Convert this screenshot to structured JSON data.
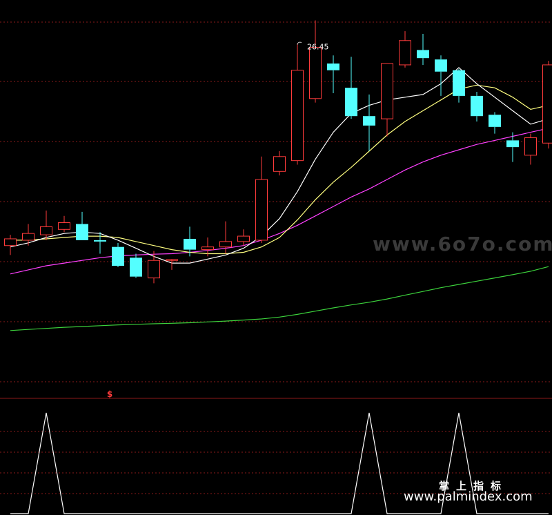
{
  "colors": {
    "background": "#000000",
    "grid": "#8b1a1a",
    "up_candle": "#ff3b3b",
    "down_candle": "#54ffff",
    "ma5": "#ffffff",
    "ma10": "#ffff80",
    "ma30": "#ff40ff",
    "ma60": "#3cd23c",
    "indicator": "#ffffff",
    "marker": "#ff3b3b"
  },
  "chart_data": [
    {
      "type": "candlestick",
      "title": "",
      "ylim": [
        13.0,
        27.0
      ],
      "grid": true,
      "high_annotation": {
        "label": "26.45",
        "candle_index": 16
      },
      "candles": [
        {
          "o": 18.1,
          "h": 18.5,
          "l": 17.75,
          "c": 18.35
        },
        {
          "o": 18.3,
          "h": 18.9,
          "l": 18.1,
          "c": 18.55
        },
        {
          "o": 18.5,
          "h": 19.4,
          "l": 18.3,
          "c": 18.8
        },
        {
          "o": 18.7,
          "h": 19.2,
          "l": 18.6,
          "c": 18.95
        },
        {
          "o": 18.9,
          "h": 19.35,
          "l": 18.4,
          "c": 18.3
        },
        {
          "o": 18.3,
          "h": 18.6,
          "l": 17.8,
          "c": 18.25
        },
        {
          "o": 18.05,
          "h": 18.2,
          "l": 17.3,
          "c": 17.35
        },
        {
          "o": 17.65,
          "h": 17.8,
          "l": 16.9,
          "c": 16.95
        },
        {
          "o": 16.9,
          "h": 17.9,
          "l": 16.7,
          "c": 17.55
        },
        {
          "o": 17.55,
          "h": 17.6,
          "l": 17.2,
          "c": 17.58
        },
        {
          "o": 18.35,
          "h": 18.8,
          "l": 17.7,
          "c": 17.95
        },
        {
          "o": 17.95,
          "h": 18.4,
          "l": 17.7,
          "c": 18.05
        },
        {
          "o": 18.05,
          "h": 19.0,
          "l": 17.8,
          "c": 18.25
        },
        {
          "o": 18.25,
          "h": 18.7,
          "l": 18.1,
          "c": 18.45
        },
        {
          "o": 18.3,
          "h": 21.4,
          "l": 18.2,
          "c": 20.55
        },
        {
          "o": 20.85,
          "h": 21.6,
          "l": 20.7,
          "c": 21.4
        },
        {
          "o": 21.25,
          "h": 25.6,
          "l": 21.1,
          "c": 24.6
        },
        {
          "o": 23.55,
          "h": 26.45,
          "l": 23.4,
          "c": 25.45
        },
        {
          "o": 24.85,
          "h": 25.15,
          "l": 23.75,
          "c": 24.6
        },
        {
          "o": 23.95,
          "h": 25.1,
          "l": 22.8,
          "c": 22.9
        },
        {
          "o": 22.9,
          "h": 23.7,
          "l": 21.6,
          "c": 22.55
        },
        {
          "o": 22.8,
          "h": 24.85,
          "l": 22.15,
          "c": 24.85
        },
        {
          "o": 24.8,
          "h": 26.05,
          "l": 24.7,
          "c": 25.7
        },
        {
          "o": 25.35,
          "h": 25.95,
          "l": 24.8,
          "c": 25.05
        },
        {
          "o": 25.0,
          "h": 25.15,
          "l": 23.65,
          "c": 24.55
        },
        {
          "o": 24.6,
          "h": 24.65,
          "l": 23.4,
          "c": 23.65
        },
        {
          "o": 23.65,
          "h": 23.8,
          "l": 22.7,
          "c": 22.9
        },
        {
          "o": 22.95,
          "h": 23.05,
          "l": 22.25,
          "c": 22.5
        },
        {
          "o": 22.0,
          "h": 22.3,
          "l": 21.2,
          "c": 21.75
        },
        {
          "o": 21.45,
          "h": 22.25,
          "l": 21.1,
          "c": 22.1
        },
        {
          "o": 21.9,
          "h": 24.95,
          "l": 21.7,
          "c": 24.8
        }
      ],
      "ma5": [
        18.05,
        18.2,
        18.4,
        18.55,
        18.6,
        18.55,
        18.3,
        18.0,
        17.7,
        17.45,
        17.45,
        17.6,
        17.75,
        18.0,
        18.45,
        19.1,
        20.1,
        21.3,
        22.3,
        23.0,
        23.3,
        23.5,
        23.6,
        23.7,
        24.1,
        24.7,
        24.1,
        23.6,
        23.1,
        22.6,
        22.8
      ],
      "ma10": [
        18.3,
        18.3,
        18.35,
        18.4,
        18.45,
        18.45,
        18.4,
        18.25,
        18.1,
        17.95,
        17.85,
        17.8,
        17.8,
        17.85,
        18.05,
        18.4,
        19.05,
        19.8,
        20.45,
        21.0,
        21.6,
        22.2,
        22.7,
        23.1,
        23.5,
        23.9,
        24.05,
        23.95,
        23.6,
        23.15,
        23.3
      ],
      "ma30": [
        17.05,
        17.2,
        17.35,
        17.45,
        17.55,
        17.65,
        17.72,
        17.75,
        17.78,
        17.8,
        17.85,
        17.92,
        18.0,
        18.1,
        18.3,
        18.55,
        18.85,
        19.2,
        19.55,
        19.9,
        20.2,
        20.55,
        20.9,
        21.2,
        21.45,
        21.65,
        21.85,
        22.0,
        22.15,
        22.3,
        22.45
      ],
      "ma60": [
        14.95,
        14.99,
        15.03,
        15.07,
        15.1,
        15.13,
        15.16,
        15.18,
        15.2,
        15.22,
        15.24,
        15.27,
        15.3,
        15.34,
        15.38,
        15.45,
        15.55,
        15.67,
        15.79,
        15.9,
        16.0,
        16.12,
        16.26,
        16.4,
        16.54,
        16.66,
        16.78,
        16.9,
        17.02,
        17.15,
        17.32
      ]
    },
    {
      "type": "line",
      "title": "",
      "ylim": [
        0,
        1
      ],
      "grid": true,
      "marker": {
        "label": "$",
        "candle_index": 5
      },
      "values": [
        0,
        0,
        1,
        0,
        0,
        0,
        0,
        0,
        0,
        0,
        0,
        0,
        0,
        0,
        0,
        0,
        0,
        0,
        0,
        0,
        1,
        0,
        0,
        0,
        0,
        1,
        0,
        0,
        0,
        0,
        0
      ]
    }
  ],
  "watermarks": {
    "big": "www.6o7o.com",
    "cn": "掌上指标",
    "url": "www.palmindex.com"
  }
}
